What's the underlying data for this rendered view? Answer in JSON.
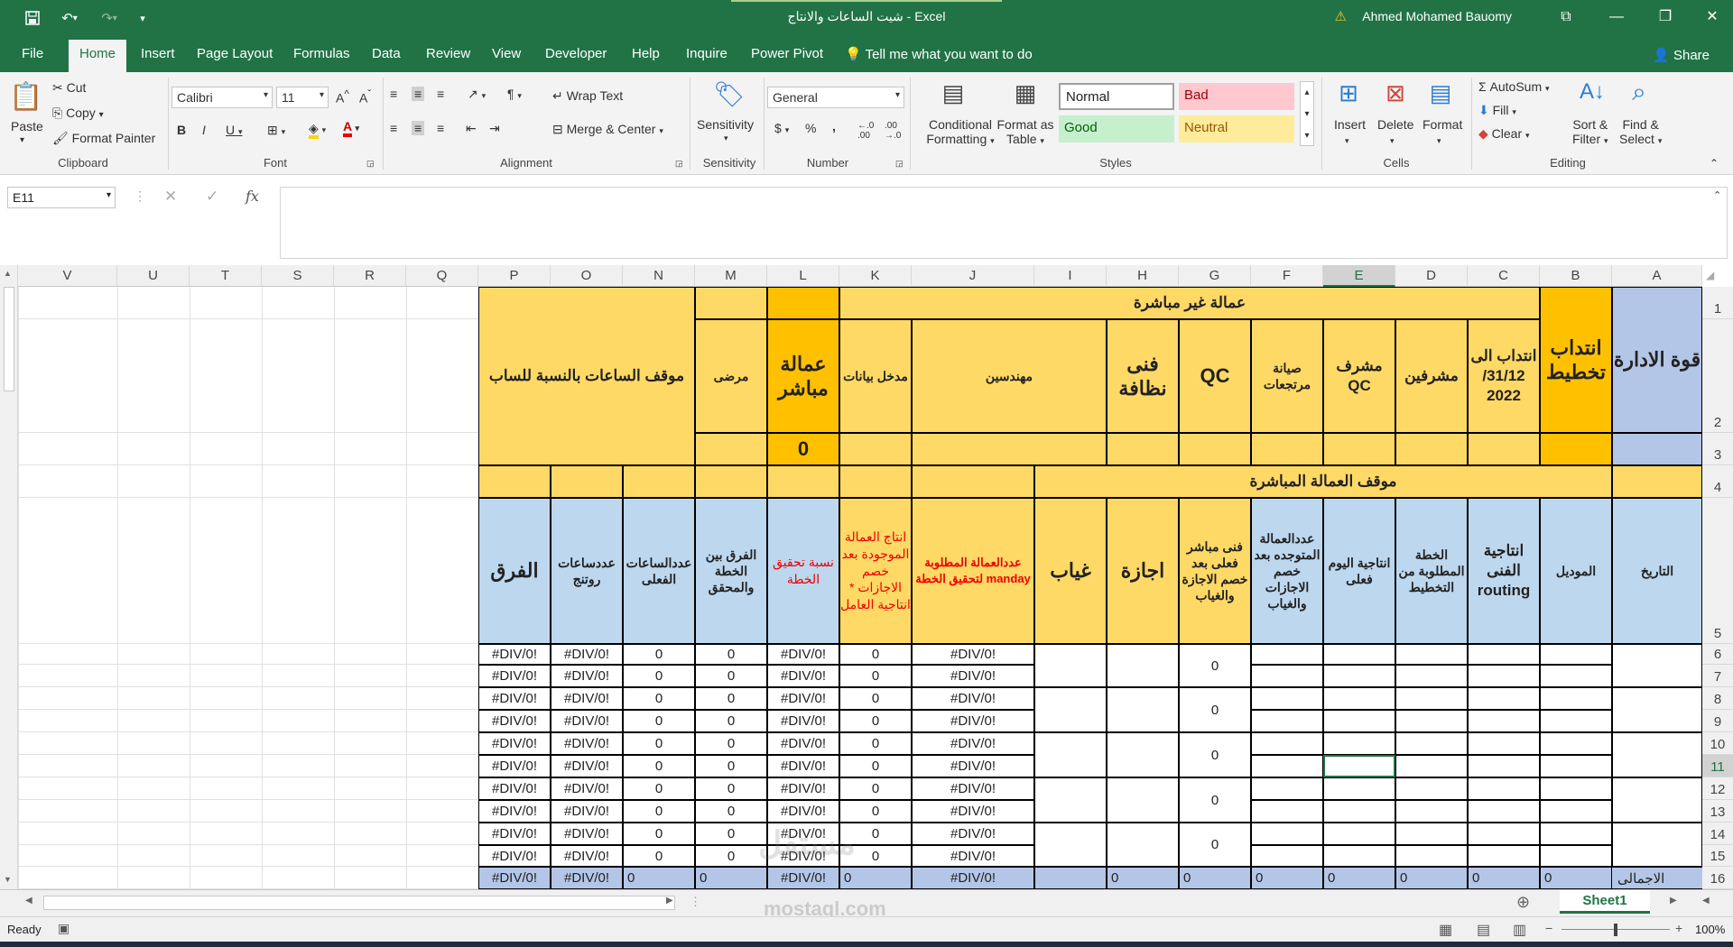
{
  "titlebar": {
    "title": "شيت الساعات والانتاج  -  Excel",
    "user": "Ahmed Mohamed Bauomy",
    "save_icon": "save-icon",
    "undo_icon": "undo-icon",
    "redo_icon": "redo-icon",
    "warning_icon": "warning-icon"
  },
  "tabs": [
    "File",
    "Home",
    "Insert",
    "Page Layout",
    "Formulas",
    "Data",
    "Review",
    "View",
    "Developer",
    "Help",
    "Inquire",
    "Power Pivot"
  ],
  "tell_me": "Tell me what you want to do",
  "share": "Share",
  "ribbon": {
    "clipboard": {
      "paste": "Paste",
      "cut": "Cut",
      "copy": "Copy",
      "format_painter": "Format Painter",
      "label": "Clipboard"
    },
    "font": {
      "name": "Calibri",
      "size": "11",
      "label": "Font"
    },
    "alignment": {
      "wrap": "Wrap Text",
      "merge": "Merge & Center",
      "label": "Alignment"
    },
    "sensitivity": {
      "button": "Sensitivity",
      "label": "Sensitivity"
    },
    "number": {
      "format": "General",
      "label": "Number"
    },
    "styles": {
      "conditional": "Conditional",
      "conditional2": "Formatting",
      "format_as": "Format as",
      "format_as2": "Table",
      "normal": "Normal",
      "bad": "Bad",
      "good": "Good",
      "neutral": "Neutral",
      "label": "Styles"
    },
    "cells": {
      "insert": "Insert",
      "delete": "Delete",
      "format": "Format",
      "label": "Cells"
    },
    "editing": {
      "autosum": "AutoSum",
      "fill": "Fill",
      "clear": "Clear",
      "sort": "Sort &",
      "sort2": "Filter",
      "find": "Find &",
      "find2": "Select",
      "label": "Editing"
    }
  },
  "formula_bar": {
    "name_box": "E11",
    "fx": "fx",
    "formula": ""
  },
  "columns": [
    "A",
    "B",
    "C",
    "D",
    "E",
    "F",
    "G",
    "H",
    "I",
    "J",
    "K",
    "L",
    "M",
    "N",
    "O",
    "P",
    "Q",
    "R",
    "S",
    "T",
    "U",
    "V"
  ],
  "selected_cell": {
    "col": "E",
    "row": 11
  },
  "rows": [
    "1",
    "2",
    "3",
    "4",
    "5",
    "6",
    "7",
    "8",
    "9",
    "10",
    "11",
    "12",
    "13",
    "14",
    "15",
    "16"
  ],
  "sheet": {
    "r1_indirect": "عمالة غير مباشرة",
    "r2": {
      "A": "قوة الادارة",
      "B": "انتداب تخطيط",
      "C": "انتداب الى 31/12/ 2022",
      "D": "مشرفين",
      "E": "مشرف QC",
      "F": "صيانة مرتجعات",
      "G": "QC",
      "H": "فنى نظافة",
      "IJ": "مهندسين",
      "K": "مدخل بيانات",
      "L": "عمالة مباشر",
      "M": "مرضى",
      "NP": "موقف الساعات بالنسبة للساب"
    },
    "r3_L": "0",
    "r4_direct": "موقف العمالة المباشرة",
    "r5": {
      "A": "التاريخ",
      "B": "الموديل",
      "C": "انتاجية الفنى routing",
      "D": "الخطة المطلوبة من التخطيط",
      "E": "انتاجية اليوم فعلى",
      "F": "عددالعمالة المتوجده بعد خصم الاجازات والغياب",
      "G": "فنى مباشر فعلى بعد خصم الاجازة والغياب",
      "H": "اجازة",
      "I": "غياب",
      "J": "عددالعمالة المطلوبة لتحقيق الخطة manday",
      "K": "انتاج العمالة الموجودة بعد خصم الاجازات * انتاجية العامل",
      "L": "نسبة تحقيق الخطة",
      "M": "الفرق بين الخطة والمحقق",
      "N": "عددالساعات الفعلى",
      "O": "عددساعات روتنج",
      "P": "الفرق"
    },
    "data_values": {
      "div": "#DIV/0!",
      "zero": "0"
    },
    "total_label": "الاجمالى"
  },
  "sheet_tab": "Sheet1",
  "status": {
    "ready": "Ready",
    "zoom": "100%"
  },
  "watermark": "mostaql.com",
  "colors": {
    "excel_green": "#217346",
    "yellow": "#ffd966",
    "orange": "#ffc000",
    "blue": "#bdd7ee",
    "purple_blue": "#b4c6e7"
  }
}
